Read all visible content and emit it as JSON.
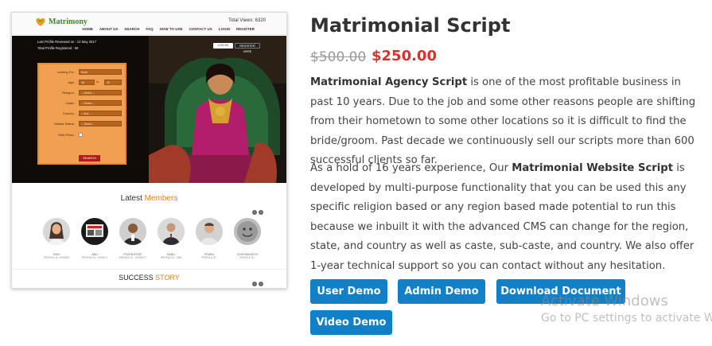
{
  "product": {
    "title": "Matrimonial Script",
    "price_old": "$500.00",
    "price_new": "$250.00",
    "para1": {
      "bold": "Matrimonial Agency Script",
      "text": " is one of the most profitable business in past 10 years. Due to the job and some other reasons people are shifting from their hometown to some other locations so it is difficult to find the bride/groom. Past decade we continuously sell our scripts more than 600 successful clients so far."
    },
    "para2": {
      "before": "As a hold of 16 years experience, Our ",
      "bold": "Matrimonial Website Script",
      "after": " is developed by multi-purpose functionality that you can be used this any specific religion based or any region based made potential to run this because we inbuilt it with the advanced CMS can change for the region, state, and country as well as caste, sub-caste, and country. We also offer 1-year technical support so you can contact without any hesitation."
    },
    "buttons": {
      "user_demo": "User Demo",
      "admin_demo": "Admin Demo",
      "download_document": "Download Document",
      "video_demo": "Video Demo"
    }
  },
  "watermark": {
    "line1": "Activate Windows",
    "line2": "Go to PC settings to activate Win"
  },
  "preview": {
    "logo_text": "Matrimony",
    "total_views": "Total Views: 6320",
    "nav": [
      "HOME",
      "ABOUT US",
      "SEARCH",
      "FAQ",
      "HOW TO USE",
      "CONTACT US",
      "LOGIN",
      "REGISTER"
    ],
    "hero_info1": "Last Profile Reviewed on : 12 May 2017",
    "hero_info2": "Total Profile Registered : 68",
    "login_label": "LOG IN",
    "register_label": "REGISTER HERE",
    "form": {
      "looking_for": "Looking For :",
      "age": "Age :",
      "to": "to",
      "religion": "Religion :",
      "caste": "Caste :",
      "country": "Country :",
      "marital_status": "Marital Status :",
      "with_photo": "With Photo :",
      "sel_looking": "Bride",
      "sel_age_from": "18",
      "sel_age_to": "30",
      "sel_religion": "-- Select --",
      "sel_caste": "-- Select --",
      "sel_country": "-- Any --",
      "sel_marital": "-- Select --",
      "search": "SEARCH"
    },
    "latest": "Latest",
    "members_word": "Members",
    "members": [
      {
        "name": "RAVI",
        "profile": "PROFILE ID : K00AF6"
      },
      {
        "name": "ANU",
        "profile": "PROFILE ID : VI0DE 3"
      },
      {
        "name": "PGIKSDFHGF",
        "profile": "PROFILE ID : VSSBX77"
      },
      {
        "name": "BABU",
        "profile": "PROFILE ID : 3R5"
      },
      {
        "name": "PRABU",
        "profile": "PROFILE ID :"
      },
      {
        "name": "DVIKYAKSHITH",
        "profile": "PROFILE ID :"
      }
    ],
    "success": "SUCCESS",
    "story": "STORY"
  },
  "colors": {
    "button_blue": "#1280c6",
    "price_red": "#d8322c",
    "accent_orange": "#e6821e"
  }
}
